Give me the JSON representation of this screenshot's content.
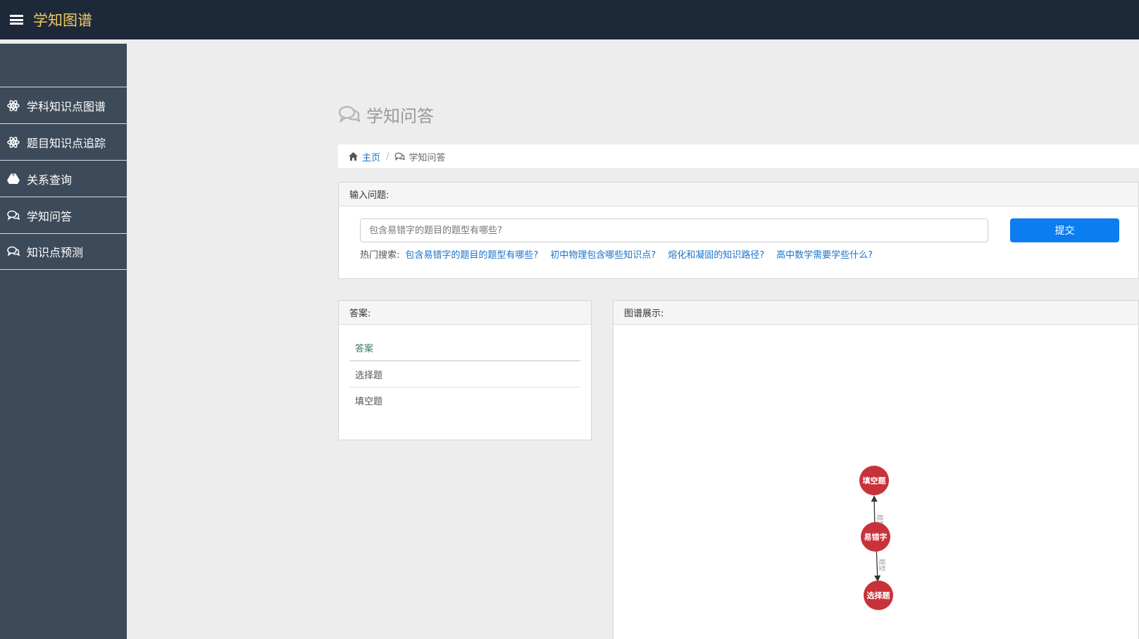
{
  "app": {
    "title": "学知图谱"
  },
  "sidebar": {
    "items": [
      {
        "label": "学科知识点图谱",
        "icon": "atom-icon"
      },
      {
        "label": "题目知识点追踪",
        "icon": "atom-icon"
      },
      {
        "label": "关系查询",
        "icon": "drive-triangle-icon"
      },
      {
        "label": "学知问答",
        "icon": "chat-bubbles-icon"
      },
      {
        "label": "知识点预测",
        "icon": "chat-bubbles-icon"
      }
    ]
  },
  "page": {
    "title": "学知问答"
  },
  "breadcrumb": {
    "home": "主页",
    "current": "学知问答"
  },
  "question": {
    "header": "输入问题:",
    "placeholder": "包含易错字的题目的题型有哪些?",
    "submit_label": "提交",
    "hot_label": "热门搜索:",
    "hot_links": [
      "包含易错字的题目的题型有哪些?",
      "初中物理包含哪些知识点?",
      "熔化和凝固的知识路径?",
      "高中数学需要学些什么?"
    ]
  },
  "answer": {
    "header": "答案:",
    "column": "答案",
    "rows": [
      "选择题",
      "填空题"
    ]
  },
  "graph": {
    "header": "图谱展示:",
    "node_color": "#c8323a",
    "nodes": [
      "填空题",
      "易错字",
      "选择题"
    ],
    "edges": [
      {
        "from": "易错字",
        "to": "填空题",
        "label": "题型"
      },
      {
        "from": "易错字",
        "to": "选择题",
        "label": "题型"
      }
    ]
  }
}
